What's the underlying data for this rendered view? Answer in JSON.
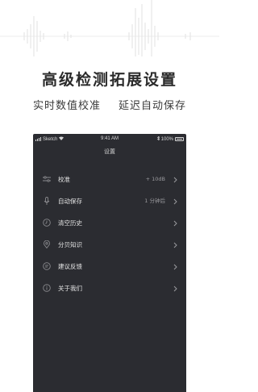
{
  "headline": "高级检测拓展设置",
  "subline": {
    "left": "实时数值校准",
    "right": "延迟自动保存"
  },
  "statusbar": {
    "carrier": "Sketch",
    "time": "9:41 AM",
    "battery": "100%"
  },
  "screen_title": "设置",
  "settings": [
    {
      "label": "校准",
      "value": "+ 10dB",
      "icon": "sliders-icon"
    },
    {
      "label": "自动保存",
      "value": "1 分钟后",
      "icon": "microphone-icon"
    },
    {
      "label": "清空历史",
      "value": "",
      "icon": "clock-icon"
    },
    {
      "label": "分贝知识",
      "value": "",
      "icon": "location-pin-icon"
    },
    {
      "label": "建议反馈",
      "value": "",
      "icon": "chat-bubble-icon"
    },
    {
      "label": "关于我们",
      "value": "",
      "icon": "info-icon"
    }
  ],
  "colors": {
    "screen_bg": "#2b2c31",
    "text_primary": "#e6e6e6",
    "text_secondary": "#9a9a9e"
  }
}
